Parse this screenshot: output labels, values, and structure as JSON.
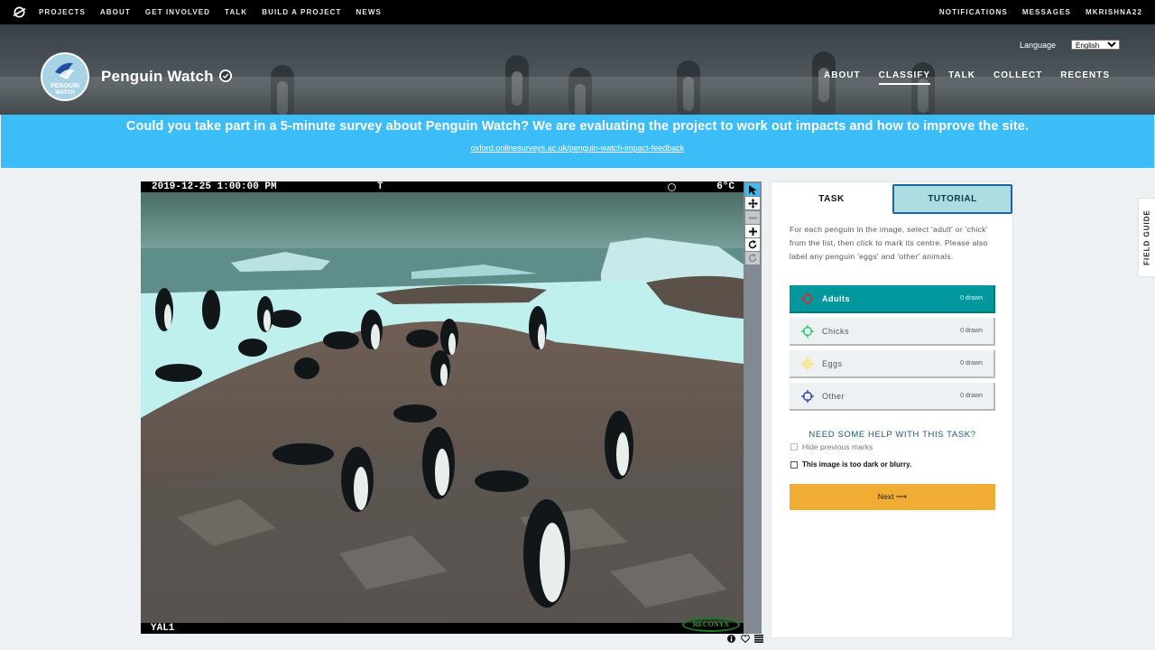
{
  "topnav": {
    "links": [
      "PROJECTS",
      "ABOUT",
      "GET INVOLVED",
      "TALK",
      "BUILD A PROJECT",
      "NEWS"
    ],
    "right": [
      "NOTIFICATIONS",
      "MESSAGES",
      "MKRISHNA22"
    ]
  },
  "project": {
    "title": "Penguin Watch",
    "avatar_text": "PENGUIN WATCH",
    "language_label": "Language",
    "language_value": "English",
    "nav": [
      "ABOUT",
      "CLASSIFY",
      "TALK",
      "COLLECT",
      "RECENTS"
    ],
    "active_nav": "CLASSIFY"
  },
  "banner": {
    "message": "Could you take part in a 5-minute survey about Penguin Watch? We are evaluating the project to work out impacts and how to improve the site.",
    "link": "oxford.onlinesurveys.ac.uk/penguin-watch-impact-feedback"
  },
  "subject": {
    "date": "2019-12-25 1:00:00 PM",
    "mode": "T",
    "temperature": "6°C",
    "location": "YAL1",
    "brand": "RECONYX"
  },
  "panel": {
    "tabs": [
      "TASK",
      "TUTORIAL"
    ],
    "instructions": "For each penguin in the image, select 'adult' or 'chick' from the list, then click to mark its centre. Please also label any penguin 'eggs' and 'other' animals.",
    "tools": [
      {
        "label": "Adults",
        "count": "0 drawn",
        "color": "#d32f2f"
      },
      {
        "label": "Chicks",
        "count": "0 drawn",
        "color": "#2ecc71"
      },
      {
        "label": "Eggs",
        "count": "0 drawn",
        "color": "#f5e663"
      },
      {
        "label": "Other",
        "count": "0 drawn",
        "color": "#3949ab"
      }
    ],
    "help": "NEED SOME HELP WITH THIS TASK?",
    "hide_marks": "Hide previous marks",
    "too_dark": "This image is too dark or blurry.",
    "next": "Next ⟶"
  },
  "field_guide": "FIELD GUIDE"
}
